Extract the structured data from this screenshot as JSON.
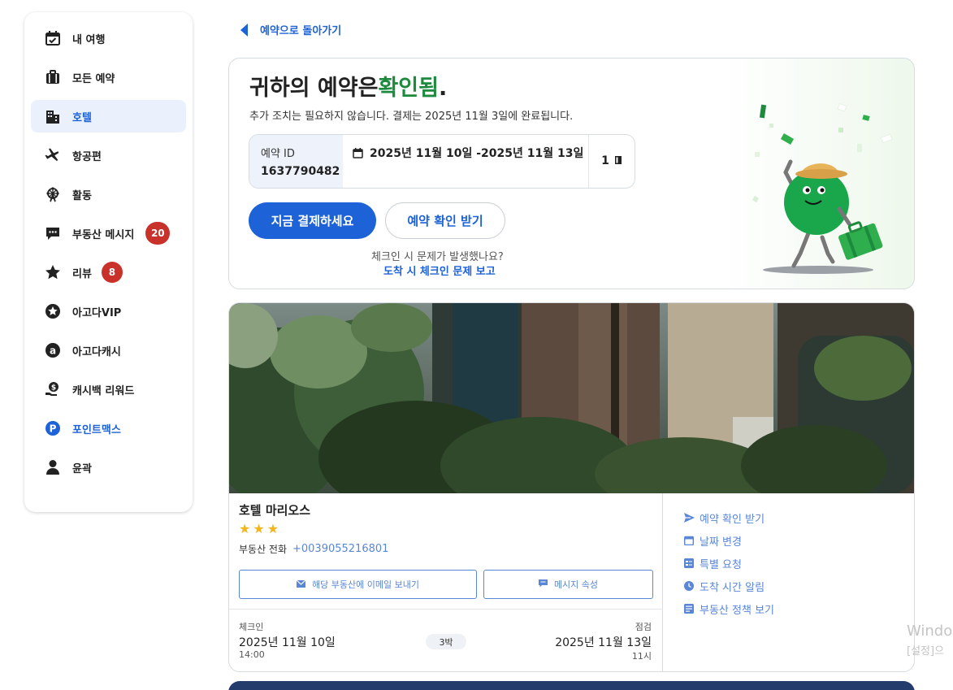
{
  "sidebar": {
    "items": [
      {
        "label": "내 여행",
        "icon": "calendar-check-icon"
      },
      {
        "label": "모든 예약",
        "icon": "briefcase-icon"
      },
      {
        "label": "호텔",
        "icon": "hotel-building-icon"
      },
      {
        "label": "항공편",
        "icon": "airplane-icon"
      },
      {
        "label": "활동",
        "icon": "ferris-wheel-icon"
      },
      {
        "label": "부동산 메시지",
        "icon": "chat-bubble-icon",
        "badge": "20"
      },
      {
        "label": "리뷰",
        "icon": "star-icon",
        "badge": "8"
      },
      {
        "label": "아고다VIP",
        "icon": "star-badge-icon"
      },
      {
        "label": "아고다캐시",
        "icon": "agoda-cash-icon"
      },
      {
        "label": "캐시백 리워드",
        "icon": "cashback-icon"
      },
      {
        "label": "포인트맥스",
        "icon": "pointsmax-icon"
      },
      {
        "label": "윤곽",
        "icon": "person-icon"
      }
    ],
    "active_index": 2
  },
  "back_link": "예약으로 돌아가기",
  "confirmation": {
    "title_prefix": "귀하의 예약은",
    "title_status": "확인됨",
    "title_suffix": ".",
    "subtitle": "추가 조치는 필요하지 않습니다. 결제는 2025년 11월 3일에 완료됩니다.",
    "booking_id_label": "예약 ID",
    "booking_id": "1637790482",
    "dates": "2025년 11월 10일 -2025년 11월 13일",
    "rooms": "1",
    "pay_button": "지금 결제하세요",
    "get_confirmation_button": "예약 확인 받기",
    "checkin_question": "체크인 시 문제가 발생했나요?",
    "checkin_report_link": "도착 시 체크인 문제 보고"
  },
  "hotel": {
    "name": "호텔 마리오스",
    "stars": 3,
    "star_glyph": "★",
    "phone_label": "부동산 전화",
    "phone": "+0039055216801",
    "email_button": "해당 부동산에 이메일 보내기",
    "message_button": "메시지 속성",
    "checkin_label": "체크인",
    "checkin_date": "2025년 11월 10일",
    "checkin_time": "14:00",
    "nights": "3박",
    "checkout_label": "점검",
    "checkout_date": "2025년 11월 13일",
    "checkout_time": "11시",
    "actions": [
      {
        "label": "예약 확인 받기",
        "icon": "send-icon"
      },
      {
        "label": "날짜 변경",
        "icon": "calendar-icon"
      },
      {
        "label": "특별 요청",
        "icon": "checklist-icon"
      },
      {
        "label": "도착 시간 알림",
        "icon": "clock-icon"
      },
      {
        "label": "부동산 정책 보기",
        "icon": "policy-icon"
      }
    ]
  },
  "watermark": {
    "line1": "Windo",
    "line2": "[설정]으"
  },
  "colors": {
    "primary_blue": "#1d62d6",
    "link_blue": "#5a86d6",
    "confirmed_green": "#1e8a3d",
    "badge_red": "#c9322b",
    "star_yellow": "#f2b51d",
    "footer_navy": "#233c6b"
  }
}
